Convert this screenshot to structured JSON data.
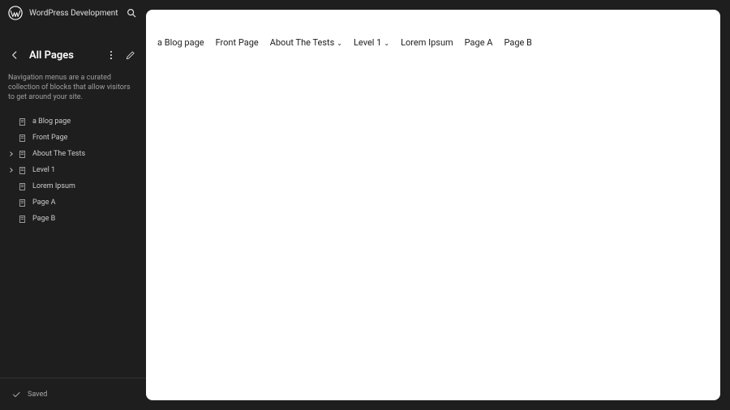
{
  "site": {
    "title": "WordPress Development"
  },
  "panel": {
    "heading": "All Pages",
    "description": "Navigation menus are a curated collection of blocks that allow visitors to get around your site."
  },
  "pages": [
    {
      "label": "a Blog page",
      "expandable": false
    },
    {
      "label": "Front Page",
      "expandable": false
    },
    {
      "label": "About The Tests",
      "expandable": true
    },
    {
      "label": "Level 1",
      "expandable": true
    },
    {
      "label": "Lorem Ipsum",
      "expandable": false
    },
    {
      "label": "Page A",
      "expandable": false
    },
    {
      "label": "Page B",
      "expandable": false
    }
  ],
  "footer": {
    "status": "Saved"
  },
  "preview_nav": [
    {
      "label": "a Blog page",
      "dropdown": false
    },
    {
      "label": "Front Page",
      "dropdown": false
    },
    {
      "label": "About The Tests",
      "dropdown": true
    },
    {
      "label": "Level 1",
      "dropdown": true
    },
    {
      "label": "Lorem Ipsum",
      "dropdown": false
    },
    {
      "label": "Page A",
      "dropdown": false
    },
    {
      "label": "Page B",
      "dropdown": false
    }
  ]
}
